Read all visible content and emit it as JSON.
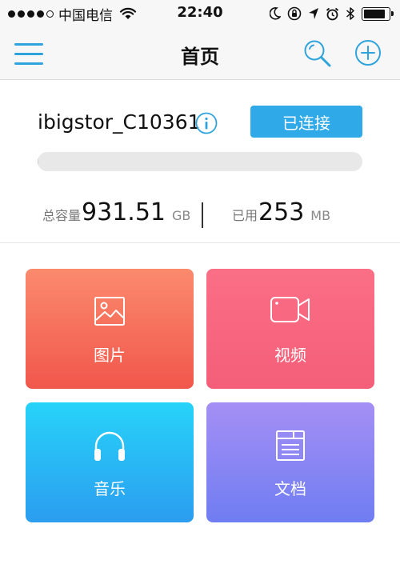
{
  "status_bar": {
    "carrier": "中国电信",
    "time": "22:40"
  },
  "nav": {
    "title": "首页"
  },
  "device": {
    "name": "ibigstor_C10361",
    "connect_label": "已连接",
    "usage_fraction": 0.0003
  },
  "capacity": {
    "total_label": "总容量",
    "total_value": "931.51",
    "total_unit": "GB",
    "used_label": "已用",
    "used_value": "253",
    "used_unit": "MB"
  },
  "tiles": [
    {
      "label": "图片",
      "icon": "image-icon"
    },
    {
      "label": "视频",
      "icon": "video-camera-icon"
    },
    {
      "label": "音乐",
      "icon": "headphones-icon"
    },
    {
      "label": "文档",
      "icon": "document-icon"
    }
  ],
  "colors": {
    "accent": "#2fa9e8",
    "photos": "#f1574c",
    "video": "#f45e78",
    "music": "#2b9df0",
    "docs": "#6f7df2"
  }
}
